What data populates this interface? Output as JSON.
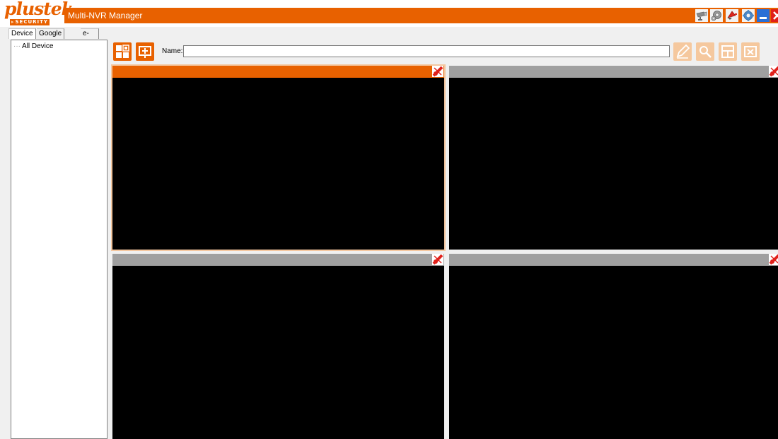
{
  "header": {
    "logo_word": "plustek",
    "logo_sub": "SECURITY",
    "title": "Multi-NVR Manager",
    "icons": [
      "camera-icon",
      "settings-gear-icon",
      "alarm-icon",
      "options-icon",
      "minimize-icon",
      "close-icon"
    ]
  },
  "tabs": [
    {
      "label": "Device",
      "active": true
    },
    {
      "label": "Google Map",
      "active": false
    },
    {
      "label": "e-Map",
      "active": false
    }
  ],
  "tree": {
    "root_label": "All Device"
  },
  "toolbar": {
    "name_label": "Name:",
    "name_value": "",
    "left_buttons": [
      "layout-grid-icon",
      "add-device-icon"
    ],
    "right_buttons": [
      "edit-icon",
      "search-icon",
      "layout-icon",
      "delete-icon"
    ]
  },
  "video_panes": [
    {
      "id": 1,
      "selected": true
    },
    {
      "id": 2,
      "selected": false
    },
    {
      "id": 3,
      "selected": false
    },
    {
      "id": 4,
      "selected": false
    }
  ],
  "colors": {
    "accent": "#e86100",
    "accent_faded": "#f5c89e",
    "pane_header": "#a0a0a0",
    "screen": "#000000",
    "close_red": "#e0201a"
  }
}
